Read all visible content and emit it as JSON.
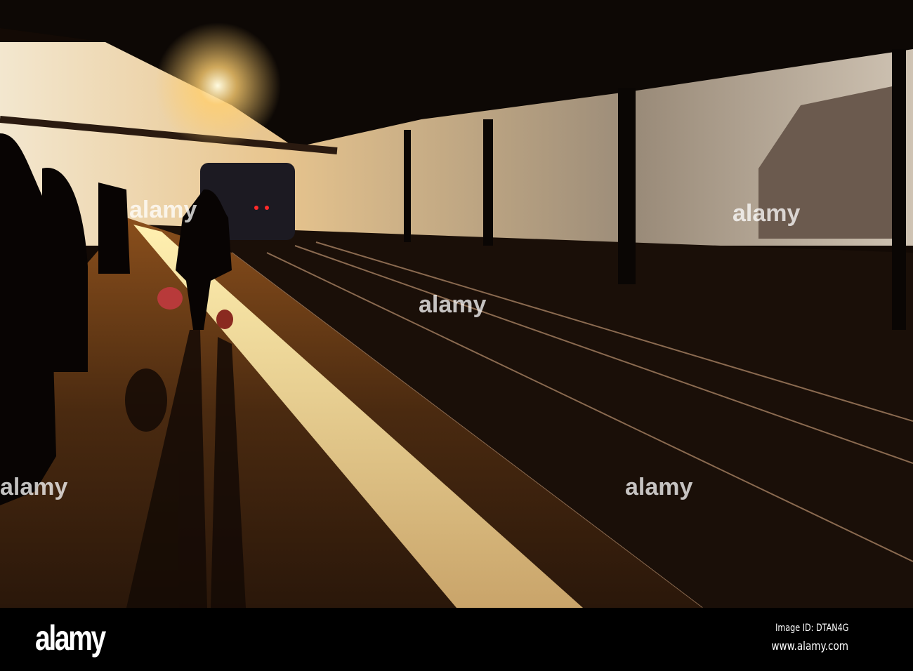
{
  "photo": {
    "subject": "Train station platform at sunset with silhouetted traveler",
    "watermark_text": "alamy"
  },
  "footer": {
    "logo": "alamy",
    "image_id": "Image ID: DTAN4G",
    "url": "www.alamy.com"
  }
}
